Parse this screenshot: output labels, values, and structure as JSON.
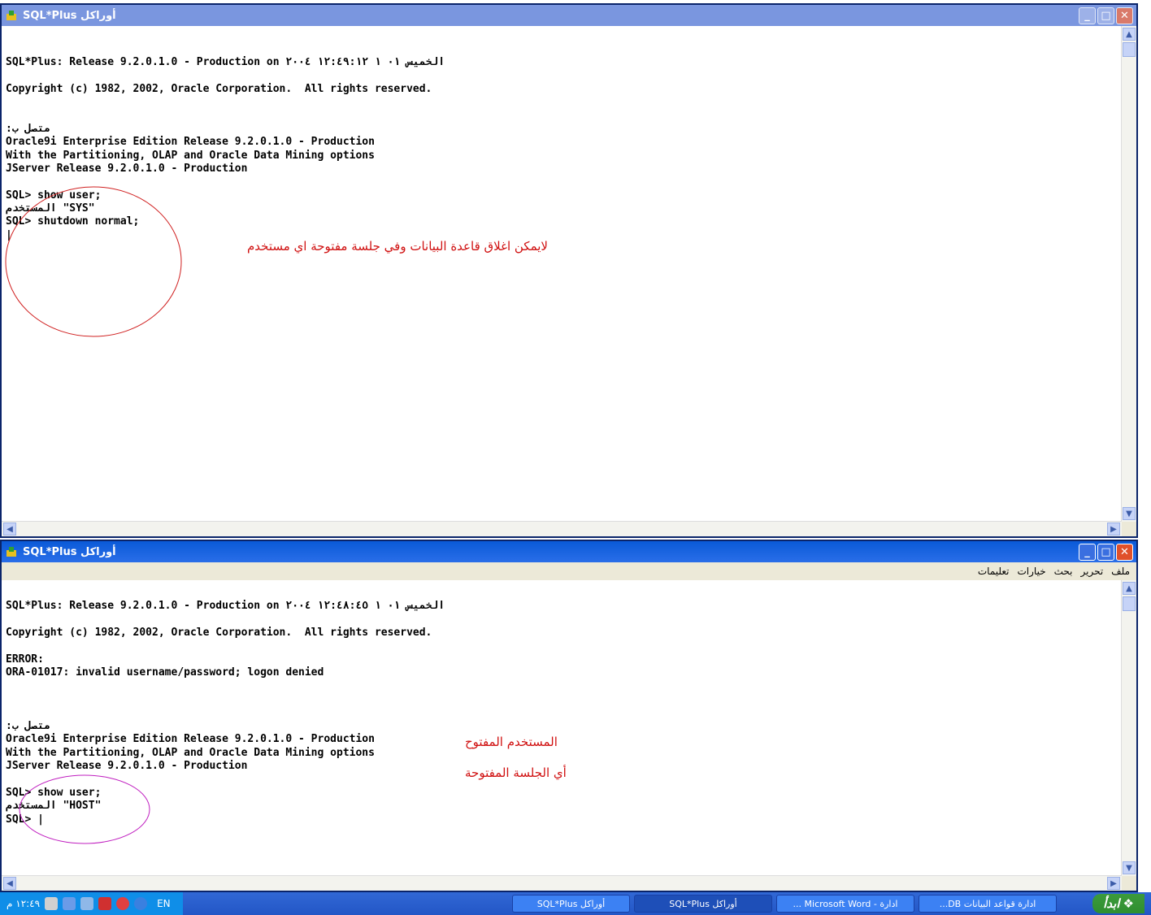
{
  "window1": {
    "title": "SQL*Plus أوراكل",
    "lines": [
      "",
      "",
      "SQL*Plus: Release 9.2.0.1.0 - Production on الخميس ٠١ ١ ١٢:٤٩:١٢ ٢٠٠٤",
      "",
      "Copyright (c) 1982, 2002, Oracle Corporation.  All rights reserved.",
      "",
      "",
      ":متصل ب",
      "Oracle9i Enterprise Edition Release 9.2.0.1.0 - Production",
      "With the Partitioning, OLAP and Oracle Data Mining options",
      "JServer Release 9.2.0.1.0 - Production",
      "",
      "SQL> show user;",
      "المستخدم \"SYS\"",
      "SQL> shutdown normal;",
      "|"
    ],
    "annotation": "لايمكن اغلاق قاعدة البيانات وفي جلسة مفتوحة اي مستخدم"
  },
  "window2": {
    "title": "SQL*Plus أوراكل",
    "menu": [
      "ملف",
      "تحرير",
      "بحث",
      "خيارات",
      "تعليمات"
    ],
    "lines": [
      "",
      "SQL*Plus: Release 9.2.0.1.0 - Production on الخميس ٠١ ١ ١٢:٤٨:٤٥ ٢٠٠٤",
      "",
      "Copyright (c) 1982, 2002, Oracle Corporation.  All rights reserved.",
      "",
      "ERROR:",
      "ORA-01017: invalid username/password; logon denied",
      "",
      "",
      "",
      ":متصل ب",
      "Oracle9i Enterprise Edition Release 9.2.0.1.0 - Production",
      "With the Partitioning, OLAP and Oracle Data Mining options",
      "JServer Release 9.2.0.1.0 - Production",
      "",
      "SQL> show user;",
      "المستخدم \"HOST\"",
      "SQL> |"
    ],
    "annotation1": "المستخدم المفتوح",
    "annotation2": "أي الجلسة المفتوحة"
  },
  "taskbar": {
    "start_label": "ابدأ",
    "tasks": [
      "ادارة قواعد البيانات DB...",
      "ادارة - Microsoft Word ...",
      "أوراكل SQL*Plus",
      "أوراكل SQL*Plus"
    ],
    "language": "EN",
    "clock": "١٢:٤٩ م"
  },
  "colors": {
    "annotation": "#d01010",
    "circle1": "#d02020",
    "circle2": "#c020c0",
    "taskbar": "#2356c6"
  }
}
